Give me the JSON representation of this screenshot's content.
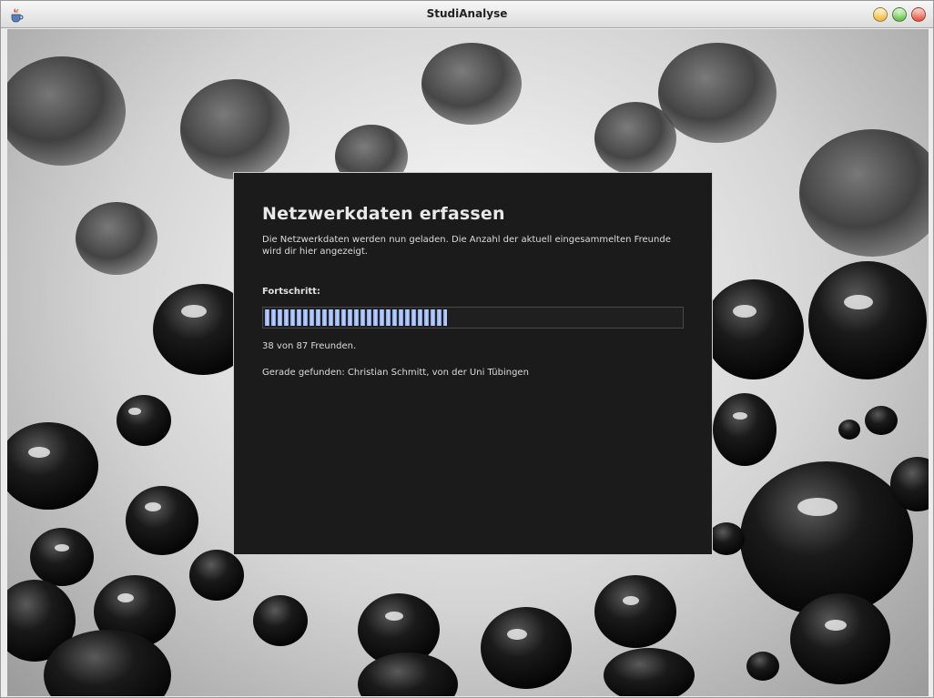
{
  "window": {
    "title": "StudiAnalyse"
  },
  "dialog": {
    "heading": "Netzwerkdaten erfassen",
    "description": "Die Netzwerkdaten werden nun geladen. Die Anzahl der aktuell eingesammelten Freunde wird dir hier angezeigt.",
    "progress_label": "Fortschritt:",
    "progress_fraction": 0.437,
    "count_text": "38 von 87 Freunden.",
    "found_text": "Gerade gefunden: Christian Schmitt, von der Uni Tübingen"
  },
  "icons": {
    "app": "java-cup-icon",
    "minimize": "minimize-icon",
    "maximize": "maximize-icon",
    "close": "close-icon"
  },
  "colors": {
    "dialog_bg": "#1b1b1b",
    "progress_fill": "#8aa7e6",
    "text": "#dcdcdc"
  }
}
